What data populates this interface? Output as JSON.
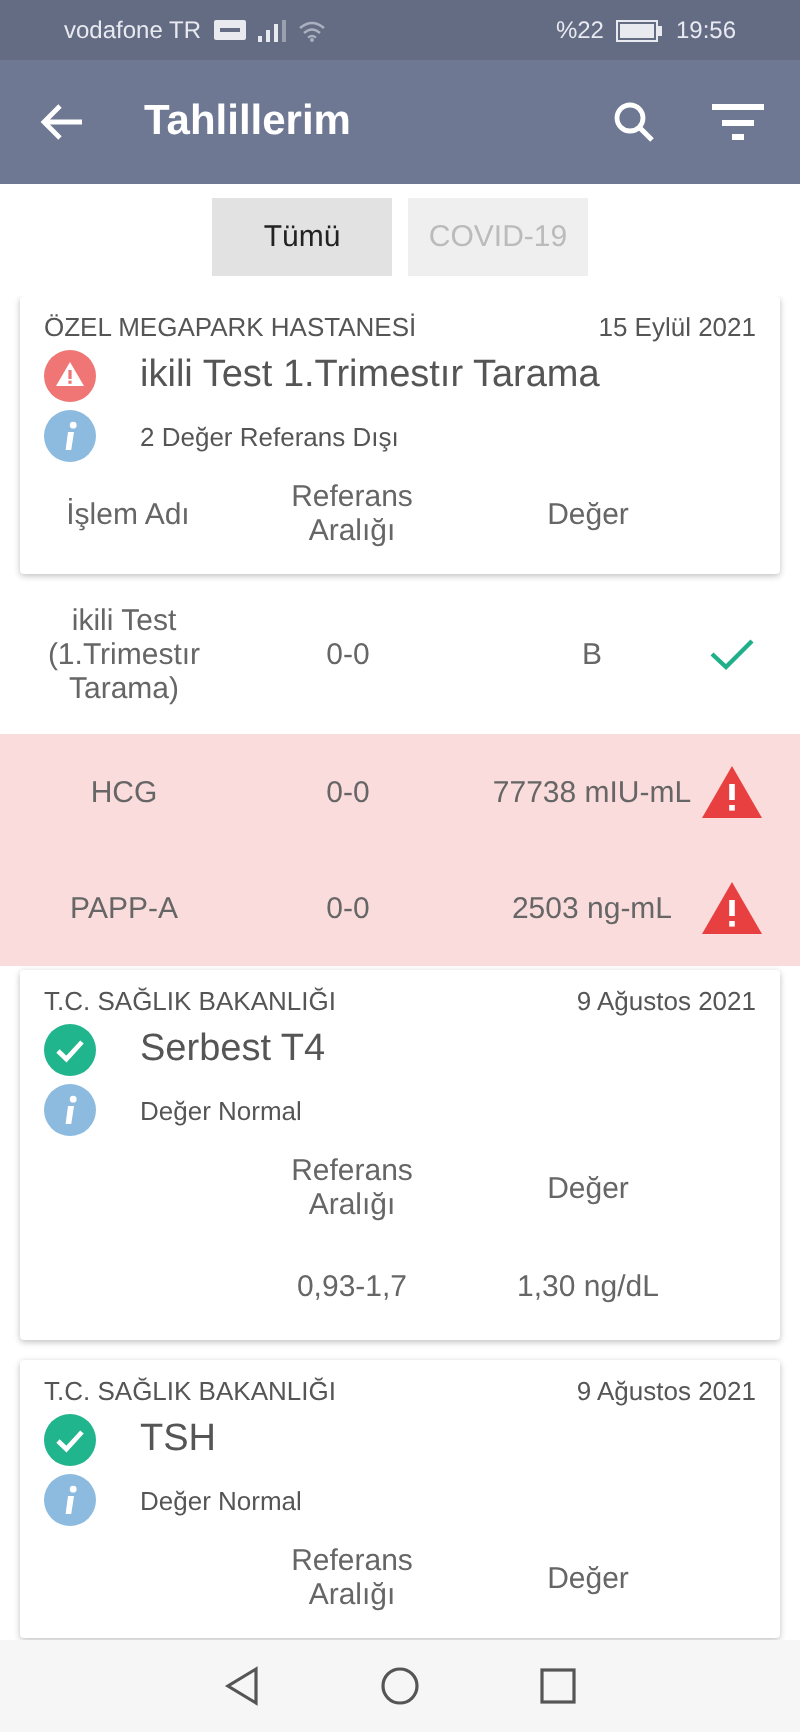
{
  "status_bar": {
    "carrier": "vodafone TR",
    "battery": "%22",
    "time": "19:56"
  },
  "app_bar": {
    "title": "Tahlillerim"
  },
  "filters": [
    {
      "label": "Tümü",
      "selected": true
    },
    {
      "label": "COVID-19",
      "selected": false
    }
  ],
  "results": [
    {
      "hospital": "ÖZEL MEGAPARK HASTANESİ",
      "date": "15 Eylül 2021",
      "title": "ikili Test 1.Trimestır Tarama",
      "out_of_range": true,
      "summary": "2 Değer Referans Dışı",
      "columns": {
        "name": "İşlem Adı",
        "reference": "Referans Aralığı",
        "value": "Değer"
      },
      "rows": [
        {
          "name": "ikili Test (1.Trimestır Tarama)",
          "reference": "0-0",
          "value": "B",
          "kind": "ok"
        },
        {
          "name": "HCG",
          "reference": "0-0",
          "value": "77738 mIU-mL",
          "kind": "out"
        },
        {
          "name": "PAPP-A",
          "reference": "0-0",
          "value": "2503 ng-mL",
          "kind": "out"
        }
      ]
    },
    {
      "hospital": "T.C. SAĞLIK BAKANLIĞI",
      "date": "9 Ağustos 2021",
      "title": "Serbest T4",
      "out_of_range": false,
      "summary": "Değer Normal",
      "columns": {
        "reference": "Referans Aralığı",
        "value": "Değer"
      },
      "rows": [
        {
          "reference": "0,93-1,7",
          "value": "1,30 ng/dL"
        }
      ]
    },
    {
      "hospital": "T.C. SAĞLIK BAKANLIĞI",
      "date": "9 Ağustos 2021",
      "title": "TSH",
      "out_of_range": false,
      "summary": "Değer Normal",
      "columns": {
        "reference": "Referans Aralığı",
        "value": "Değer"
      }
    }
  ]
}
